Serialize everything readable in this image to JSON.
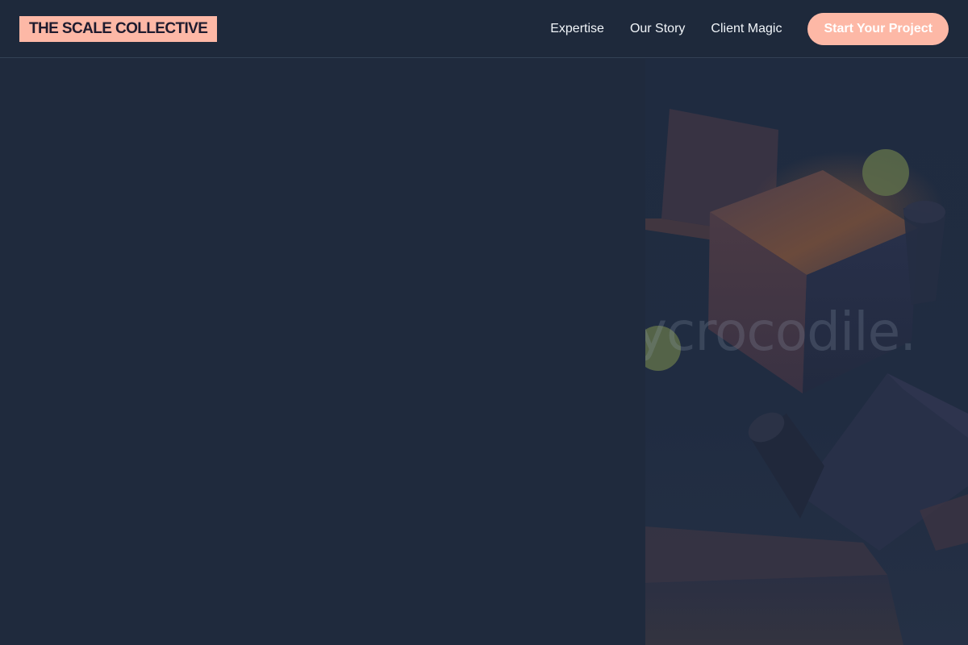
{
  "header": {
    "logo_text": "THE SCALE COLLECTIVE",
    "nav": [
      {
        "label": "Expertise"
      },
      {
        "label": "Our Story"
      },
      {
        "label": "Client Magic"
      }
    ],
    "cta_label": "Start Your Project"
  },
  "hero": {
    "watermark_text": "ycrocodile."
  },
  "colors": {
    "background": "#1e293b",
    "accent": "#fdb8a6",
    "nav_text": "#f1f5f9"
  }
}
